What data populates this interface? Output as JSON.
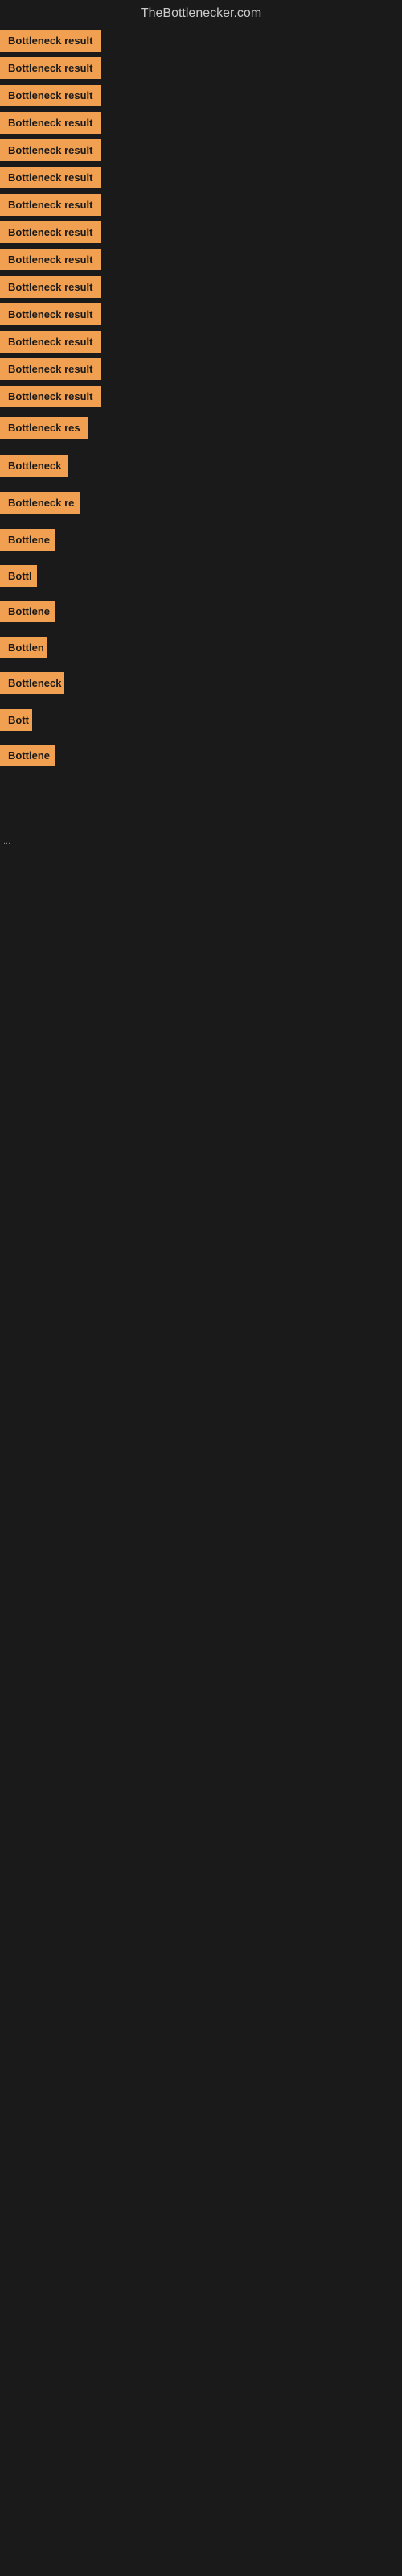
{
  "site": {
    "title": "TheBottlenecker.com"
  },
  "items": [
    {
      "id": 1,
      "label": "Bottleneck result",
      "badgeClass": "badge-full",
      "spacing": 45
    },
    {
      "id": 2,
      "label": "Bottleneck result",
      "badgeClass": "badge-full",
      "spacing": 45
    },
    {
      "id": 3,
      "label": "Bottleneck result",
      "badgeClass": "badge-full",
      "spacing": 45
    },
    {
      "id": 4,
      "label": "Bottleneck result",
      "badgeClass": "badge-full",
      "spacing": 45
    },
    {
      "id": 5,
      "label": "Bottleneck result",
      "badgeClass": "badge-full",
      "spacing": 45
    },
    {
      "id": 6,
      "label": "Bottleneck result",
      "badgeClass": "badge-full",
      "spacing": 45
    },
    {
      "id": 7,
      "label": "Bottleneck result",
      "badgeClass": "badge-full",
      "spacing": 45
    },
    {
      "id": 8,
      "label": "Bottleneck result",
      "badgeClass": "badge-full",
      "spacing": 45
    },
    {
      "id": 9,
      "label": "Bottleneck result",
      "badgeClass": "badge-full",
      "spacing": 45
    },
    {
      "id": 10,
      "label": "Bottleneck result",
      "badgeClass": "badge-full",
      "spacing": 45
    },
    {
      "id": 11,
      "label": "Bottleneck result",
      "badgeClass": "badge-full",
      "spacing": 45
    },
    {
      "id": 12,
      "label": "Bottleneck result",
      "badgeClass": "badge-full",
      "spacing": 45
    },
    {
      "id": 13,
      "label": "Bottleneck result",
      "badgeClass": "badge-full",
      "spacing": 45
    },
    {
      "id": 14,
      "label": "Bottleneck result",
      "badgeClass": "badge-full",
      "spacing": 45
    },
    {
      "id": 15,
      "label": "Bottleneck res",
      "badgeClass": "badge-w1",
      "spacing": 45
    },
    {
      "id": 16,
      "label": "Bottleneck",
      "badgeClass": "badge-w3",
      "spacing": 40
    },
    {
      "id": 17,
      "label": "Bottleneck re",
      "badgeClass": "badge-w2",
      "spacing": 40
    },
    {
      "id": 18,
      "label": "Bottlene",
      "badgeClass": "badge-w5",
      "spacing": 38
    },
    {
      "id": 19,
      "label": "Bottl",
      "badgeClass": "badge-w7",
      "spacing": 35
    },
    {
      "id": 20,
      "label": "Bottlene",
      "badgeClass": "badge-w6",
      "spacing": 38
    },
    {
      "id": 21,
      "label": "Bottlen",
      "badgeClass": "badge-w8",
      "spacing": 35
    },
    {
      "id": 22,
      "label": "Bottleneck",
      "badgeClass": "badge-w4",
      "spacing": 40
    },
    {
      "id": 23,
      "label": "Bott",
      "badgeClass": "badge-w9",
      "spacing": 35
    },
    {
      "id": 24,
      "label": "Bottlene",
      "badgeClass": "badge-w6",
      "spacing": 38
    }
  ],
  "ellipsis": "...",
  "colors": {
    "badge_bg": "#f0a050",
    "page_bg": "#1a1a1a",
    "header_text": "#cccccc"
  }
}
